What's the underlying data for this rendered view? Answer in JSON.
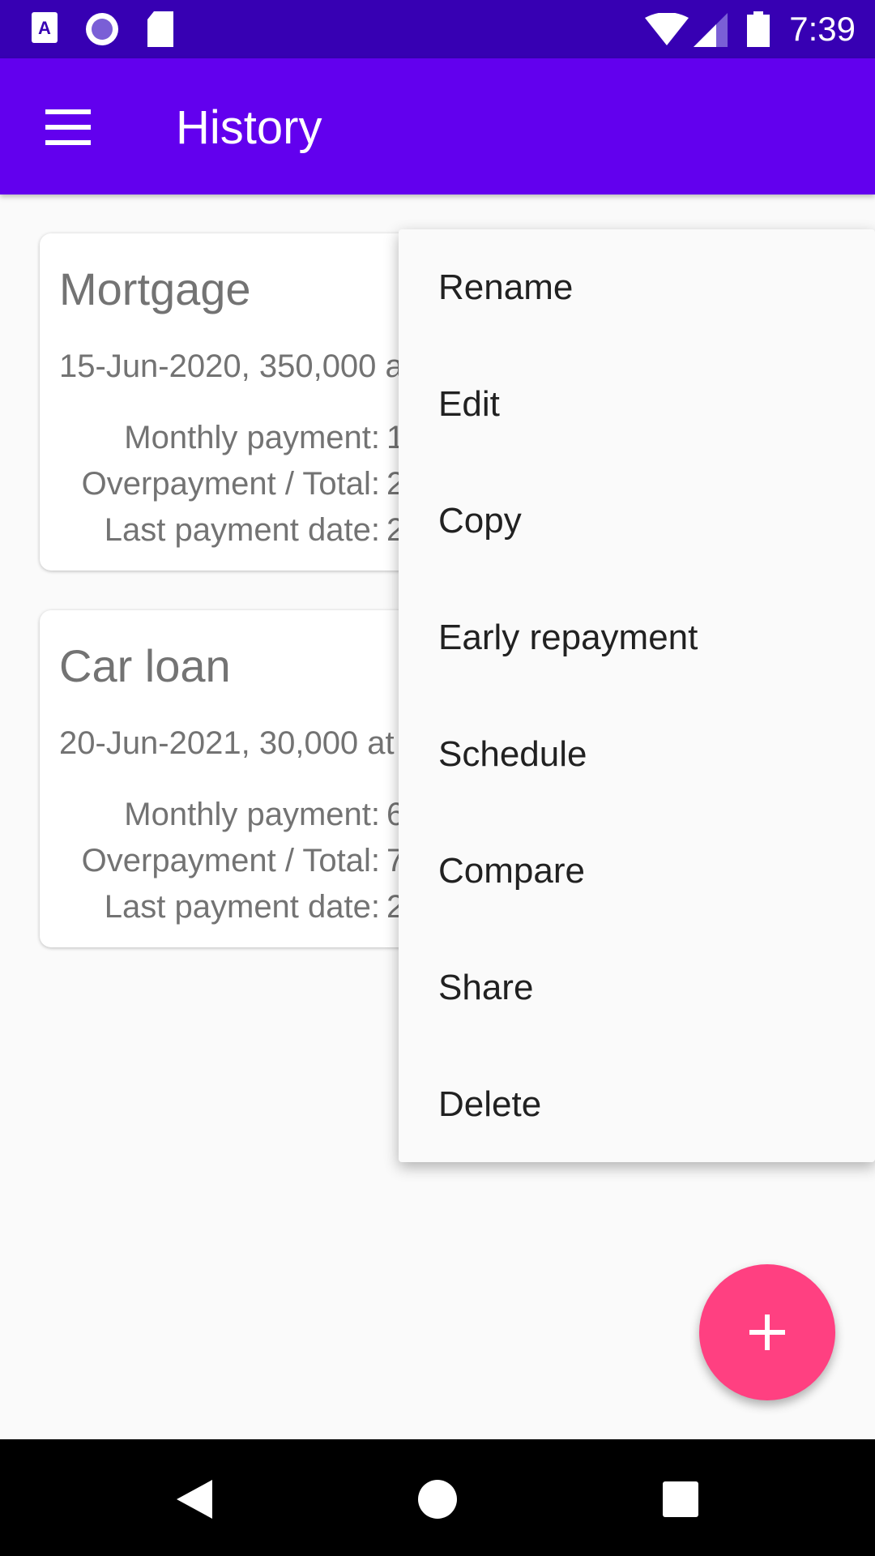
{
  "status_bar": {
    "time": "7:39",
    "icons": [
      "accessibility-icon",
      "record-icon",
      "sd-card-icon",
      "wifi-icon",
      "signal-icon",
      "battery-icon"
    ]
  },
  "app_bar": {
    "title": "History",
    "menu_icon": "hamburger-icon",
    "color": "#6200ee"
  },
  "cards": [
    {
      "name": "Mortgage",
      "summary": "15-Jun-2020, 350,000 a",
      "rows": [
        {
          "label": "Monthly payment:",
          "value": "1"
        },
        {
          "label": "Overpayment / Total:",
          "value": "2"
        },
        {
          "label": "Last payment date:",
          "value": "2"
        }
      ]
    },
    {
      "name": "Car loan",
      "summary": "20-Jun-2021, 30,000 at",
      "rows": [
        {
          "label": "Monthly payment:",
          "value": "6"
        },
        {
          "label": "Overpayment / Total:",
          "value": "7"
        },
        {
          "label": "Last payment date:",
          "value": "2"
        }
      ]
    }
  ],
  "context_menu": {
    "items": [
      "Rename",
      "Edit",
      "Copy",
      "Early repayment",
      "Schedule",
      "Compare",
      "Share",
      "Delete"
    ]
  },
  "fab": {
    "icon": "plus-icon",
    "color": "#ff4081"
  },
  "nav_bar": {
    "icons": [
      "back-icon",
      "home-icon",
      "recents-icon"
    ]
  }
}
